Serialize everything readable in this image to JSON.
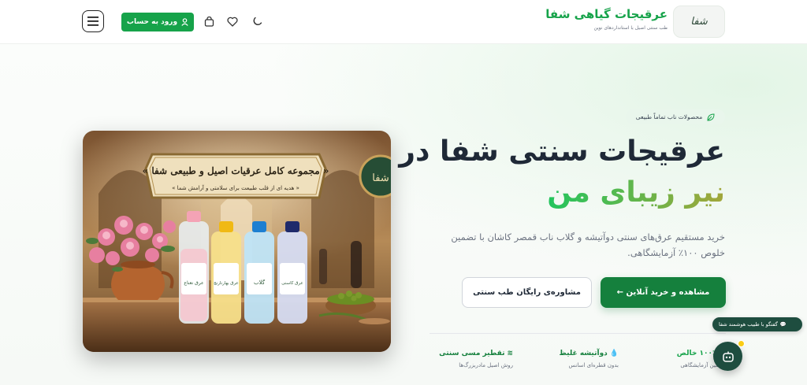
{
  "header": {
    "brand_title": "عرقیجات گیاهی شفا",
    "brand_subtitle": "طب سنتی اصیل با استانداردهای نوین",
    "logo_text": "شفا",
    "login_label": "ورود به حساب",
    "icons": [
      "menu-icon",
      "user-icon",
      "cart-icon",
      "heart-icon",
      "moon-icon"
    ]
  },
  "hero": {
    "badge": "محصولات ناب تماماً طبیعی",
    "headline_line1": "عرقیجات سنتی شفا در",
    "headline_line2": "نیر زیبای من",
    "description": "خرید مستقیم عرق‌های سنتی دوآتیشه و گلاب ناب قمصر کاشان با تضمین خلوص ۱۰۰٪ آزمایشگاهی.",
    "primary_cta": "مشاهده و خرید آنلاین ←",
    "secondary_cta": "مشاوره‌ی رایگان طب سنتی"
  },
  "hero_image": {
    "banner_title": "« مجموعه کامل عرقیات اصیل و طبیعی شفا »",
    "banner_subtitle": "« هدیه ای از قلب طبیعت برای سلامتی و آرامش شما »",
    "emblem_text": "شفا",
    "bottles": [
      {
        "label": "عرق نعناع",
        "brand": "شفا",
        "liquid": "#f5c7cf",
        "cap": "#f4a3b5"
      },
      {
        "label": "عرق بهارنارنج",
        "brand": "شفا",
        "liquid": "#f7df8a",
        "cap": "#f0b914"
      },
      {
        "label": "گلاب",
        "brand": "شفا",
        "liquid": "#bfe4f7",
        "cap": "#1d7fd1"
      },
      {
        "label": "عرق کاسنی",
        "brand": "شفا",
        "liquid": "#d6dcf2",
        "cap": "#1f2a6b"
      }
    ]
  },
  "features": [
    {
      "title": "تقطیر مسی سنتی",
      "subtitle": "روش اصیل مادربزرگ‌ها",
      "icon": "waves-icon"
    },
    {
      "title": "دوآتیشه غلیظ",
      "subtitle": "بدون قطره‌ای اسانس",
      "icon": "drop-icon"
    },
    {
      "title": "۱۰۰٪ خالص",
      "subtitle": "تضمین آزمایشگاهی",
      "icon": "check-icon"
    }
  ],
  "chat": {
    "pill_text": "گفتگو با طبیب هوشمند شفا",
    "icon": "robot-icon"
  },
  "colors": {
    "primary": "#16a34a",
    "primary_dark": "#15803d",
    "chat_bg": "#1e4d3f"
  }
}
